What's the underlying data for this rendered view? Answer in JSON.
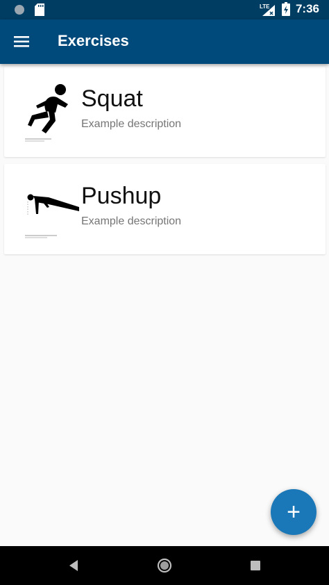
{
  "status_bar": {
    "time": "7:36",
    "icons": [
      "circle-notification-icon",
      "sd-card-icon",
      "signal-lte-icon",
      "battery-charging-icon"
    ],
    "network_label": "LTE"
  },
  "app_bar": {
    "title": "Exercises",
    "menu_icon": "hamburger-menu-icon"
  },
  "exercises": [
    {
      "name": "Squat",
      "description": "Example description",
      "icon": "squat-icon"
    },
    {
      "name": "Pushup",
      "description": "Example description",
      "icon": "pushup-icon"
    }
  ],
  "fab": {
    "label": "+",
    "icon": "add-icon"
  },
  "nav_bar": {
    "icons": [
      "back-icon",
      "home-icon",
      "recents-icon"
    ]
  },
  "colors": {
    "status_bar": "#003d63",
    "app_bar": "#004a7b",
    "fab": "#1a78b8",
    "background": "#fafafa"
  }
}
